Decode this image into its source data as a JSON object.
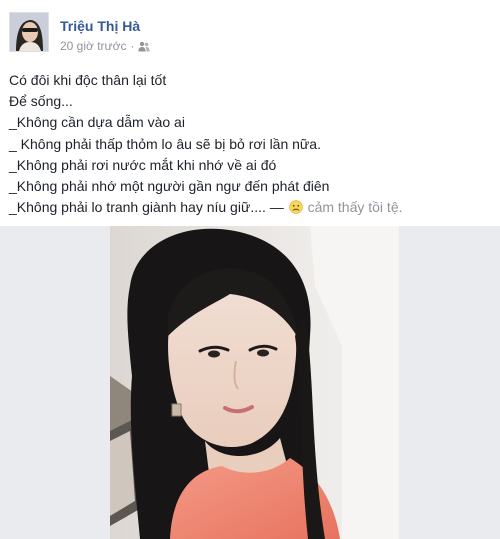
{
  "post": {
    "author_name": "Triệu Thị Hà",
    "timestamp": "20 giờ trước",
    "audience_icon": "friends-icon",
    "lines": [
      "Có đôi khi độc thân lại tốt",
      "Để sống...",
      "_Không cần dựa dẫm vào ai",
      "_ Không phải thấp thỏm lo âu sẽ bị bỏ rơi lần nữa.",
      "_Không phải rơi nước mắt khi nhớ về ai đó",
      "_Không phải nhớ một người gần ngư đến phát điên"
    ],
    "last_line_text": "_Không phải lo tranh giành hay níu giữ.... —",
    "feeling_icon": "sad-face-icon",
    "feeling_text": "cảm thấy tồi tệ."
  },
  "colors": {
    "name_blue": "#365899",
    "meta_gray": "#90949c",
    "text_dark": "#1d2129",
    "feed_bg": "#e9ebee"
  }
}
